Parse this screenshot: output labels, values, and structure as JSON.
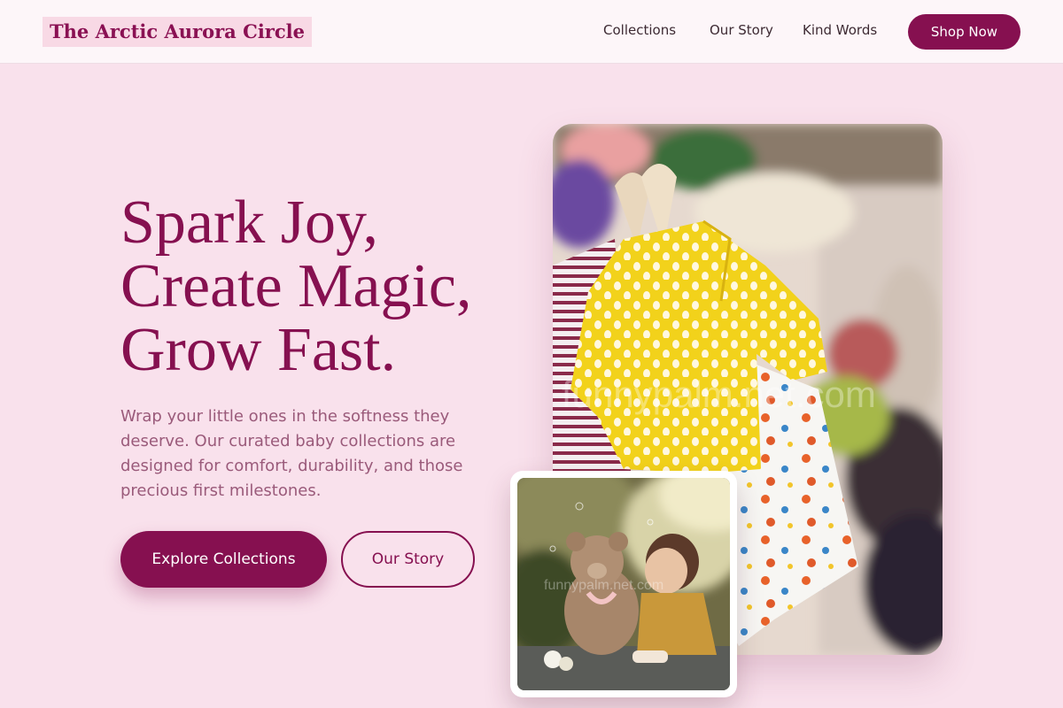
{
  "brand": {
    "name": "The Arctic Aurora Circle"
  },
  "nav": {
    "links": [
      "Collections",
      "Our Story",
      "Kind Words"
    ],
    "cta": "Shop Now"
  },
  "hero": {
    "title_lines": [
      "Spark Joy,",
      "Create Magic,",
      "Grow Fast."
    ],
    "description": "Wrap your little ones in the softness they deserve. Our curated baby collections are designed for comfort, durability, and those precious first milestones.",
    "primary_button": "Explore Collections",
    "secondary_button": "Our Story"
  },
  "images": {
    "main_watermark": "funnypalm.net.com",
    "small_watermark": "funnypalm.net.com"
  },
  "colors": {
    "accent": "#861050",
    "page_background": "#f9e1ec",
    "header_background": "#fdf6f9"
  }
}
